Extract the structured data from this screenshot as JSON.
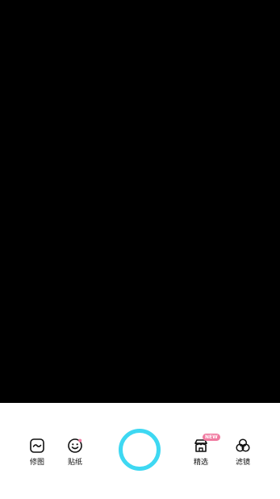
{
  "colors": {
    "viewport_bg": "#000000",
    "bar_bg": "#ffffff",
    "shutter_ring": "#3ed8f2",
    "badge_bg": "#f07aa0",
    "sticker_dot": "#f07aa0",
    "icon_stroke": "#111111"
  },
  "toolbar": {
    "left": [
      {
        "label": "修图",
        "icon": "retouch-icon"
      },
      {
        "label": "贴纸",
        "icon": "smiley-sticker-icon"
      }
    ],
    "right": [
      {
        "label": "精选",
        "icon": "featured-icon",
        "badge": "NEW"
      },
      {
        "label": "滤镜",
        "icon": "filters-icon"
      }
    ]
  }
}
